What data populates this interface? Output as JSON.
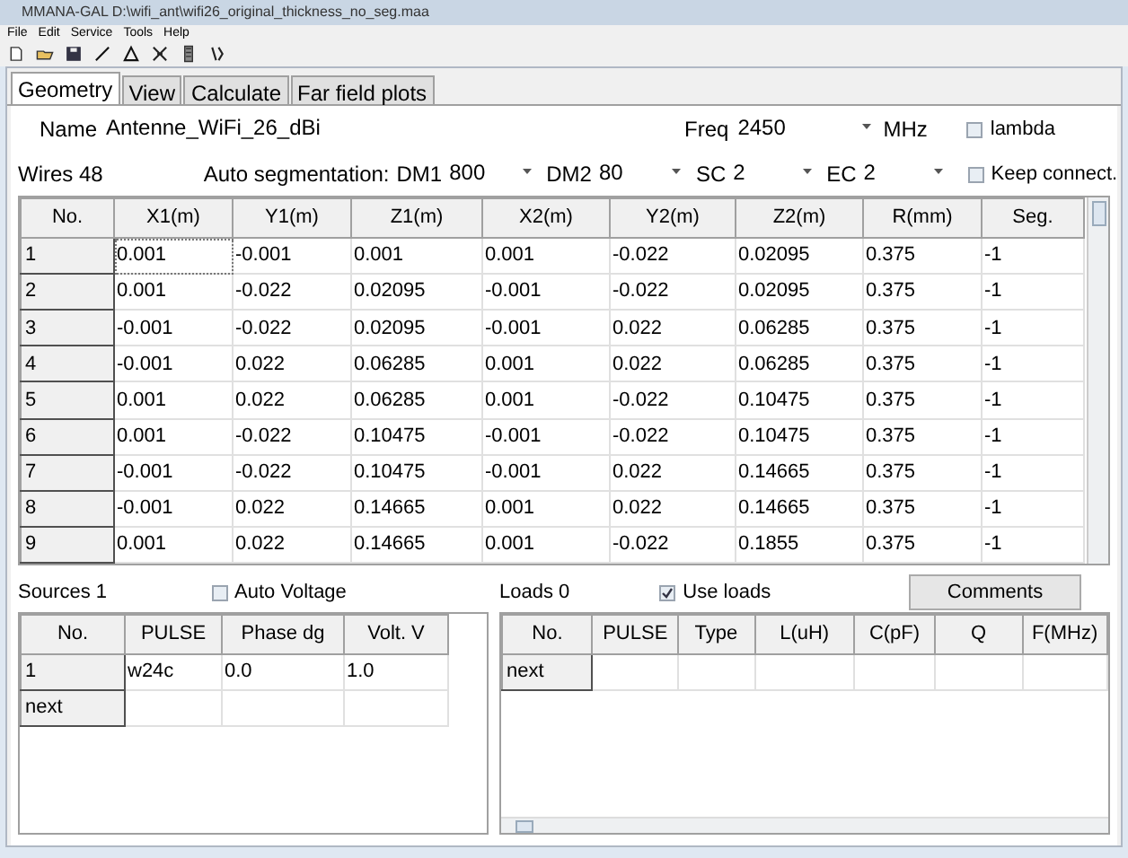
{
  "window": {
    "title": "MMANA-GAL D:\\wifi_ant\\wifi26_original_thickness_no_seg.maa"
  },
  "menu": [
    "File",
    "Edit",
    "Service",
    "Tools",
    "Help"
  ],
  "tabs": [
    {
      "label": "Geometry",
      "selected": true
    },
    {
      "label": "View",
      "selected": false
    },
    {
      "label": "Calculate",
      "selected": false
    },
    {
      "label": "Far field plots",
      "selected": false
    }
  ],
  "name": {
    "label": "Name",
    "value": "Antenne_WiFi_26_dBi"
  },
  "freq": {
    "label": "Freq",
    "value": "2450",
    "unit": "MHz"
  },
  "lambda": {
    "label": "lambda",
    "checked": false
  },
  "wires_count": "Wires 48",
  "auto_segmentation": {
    "label": "Auto segmentation:",
    "fields": [
      {
        "label": "DM1",
        "value": "800"
      },
      {
        "label": "DM2",
        "value": "80"
      },
      {
        "label": "SC",
        "value": "2"
      },
      {
        "label": "EC",
        "value": "2"
      }
    ]
  },
  "keep_connect": {
    "label": "Keep connect.",
    "checked": false
  },
  "wires": {
    "columns": [
      "No.",
      "X1(m)",
      "Y1(m)",
      "Z1(m)",
      "X2(m)",
      "Y2(m)",
      "Z2(m)",
      "R(mm)",
      "Seg."
    ],
    "rows": [
      [
        "1",
        "0.001",
        "-0.001",
        "0.001",
        "0.001",
        "-0.022",
        "0.02095",
        "0.375",
        "-1"
      ],
      [
        "2",
        "0.001",
        "-0.022",
        "0.02095",
        "-0.001",
        "-0.022",
        "0.02095",
        "0.375",
        "-1"
      ],
      [
        "3",
        "-0.001",
        "-0.022",
        "0.02095",
        "-0.001",
        "0.022",
        "0.06285",
        "0.375",
        "-1"
      ],
      [
        "4",
        "-0.001",
        "0.022",
        "0.06285",
        "0.001",
        "0.022",
        "0.06285",
        "0.375",
        "-1"
      ],
      [
        "5",
        "0.001",
        "0.022",
        "0.06285",
        "0.001",
        "-0.022",
        "0.10475",
        "0.375",
        "-1"
      ],
      [
        "6",
        "0.001",
        "-0.022",
        "0.10475",
        "-0.001",
        "-0.022",
        "0.10475",
        "0.375",
        "-1"
      ],
      [
        "7",
        "-0.001",
        "-0.022",
        "0.10475",
        "-0.001",
        "0.022",
        "0.14665",
        "0.375",
        "-1"
      ],
      [
        "8",
        "-0.001",
        "0.022",
        "0.14665",
        "0.001",
        "0.022",
        "0.14665",
        "0.375",
        "-1"
      ],
      [
        "9",
        "0.001",
        "0.022",
        "0.14665",
        "0.001",
        "-0.022",
        "0.1855",
        "0.375",
        "-1"
      ]
    ]
  },
  "sources": {
    "title": "Sources 1",
    "auto_voltage": {
      "label": "Auto Voltage",
      "checked": false
    },
    "columns": [
      "No.",
      "PULSE",
      "Phase dg",
      "Volt. V"
    ],
    "rows": [
      [
        "1",
        "w24c",
        "0.0",
        "1.0"
      ],
      [
        "next",
        "",
        "",
        ""
      ]
    ]
  },
  "loads": {
    "title": "Loads 0",
    "use_loads": {
      "label": "Use loads",
      "checked": true
    },
    "comments_button": "Comments",
    "columns": [
      "No.",
      "PULSE",
      "Type",
      "L(uH)",
      "C(pF)",
      "Q",
      "F(MHz)"
    ],
    "rows": [
      [
        "next",
        "",
        "",
        "",
        "",
        "",
        ""
      ]
    ]
  }
}
